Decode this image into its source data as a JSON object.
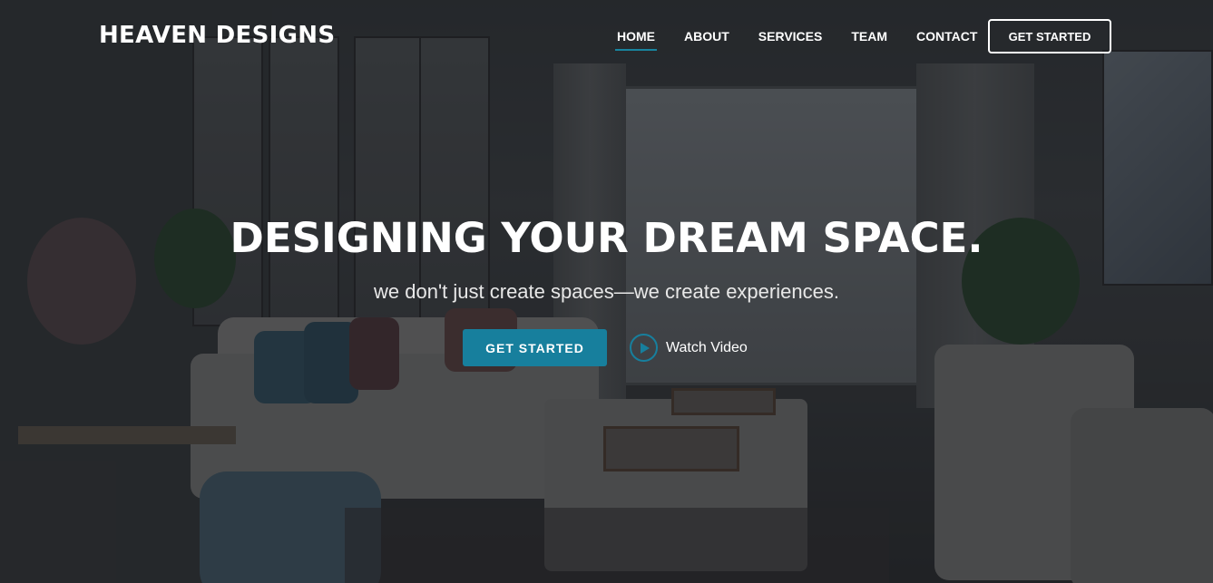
{
  "brand": {
    "name": "HEAVEN DESIGNS"
  },
  "nav": {
    "items": [
      {
        "label": "HOME",
        "active": true
      },
      {
        "label": "ABOUT",
        "active": false
      },
      {
        "label": "SERVICES",
        "active": false
      },
      {
        "label": "TEAM",
        "active": false
      },
      {
        "label": "CONTACT",
        "active": false
      }
    ],
    "cta_label": "GET STARTED"
  },
  "hero": {
    "title": "DESIGNING YOUR DREAM SPACE.",
    "subtitle": "we don't just create spaces—we create experiences.",
    "primary_button": "GET STARTED",
    "video_link": "Watch Video"
  },
  "colors": {
    "accent": "#177f9d",
    "text": "#ffffff"
  },
  "icons": {
    "play": "play-icon"
  }
}
